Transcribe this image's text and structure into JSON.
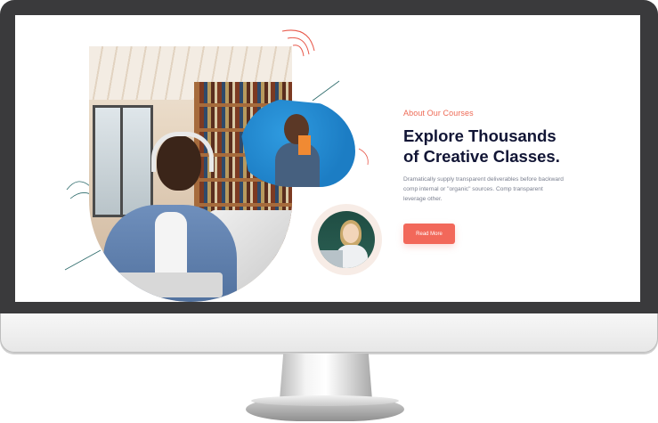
{
  "hero": {
    "eyebrow": "About Our Courses",
    "headline_line1": "Explore Thousands",
    "headline_line2": "of Creative Classes.",
    "description": "Dramatically supply transparent deliverables before backward comp internal or \"organic\" sources. Comp transparent leverage other.",
    "button_label": "Read More"
  },
  "colors": {
    "accent": "#f2685a",
    "eyebrow": "#ee6a55",
    "heading": "#111535",
    "body_text": "#7a7f8f",
    "bezel": "#3a3a3c"
  },
  "images": [
    {
      "name": "student-with-headphones-photo"
    },
    {
      "name": "student-holding-book-photo"
    },
    {
      "name": "student-with-laptop-photo"
    }
  ]
}
